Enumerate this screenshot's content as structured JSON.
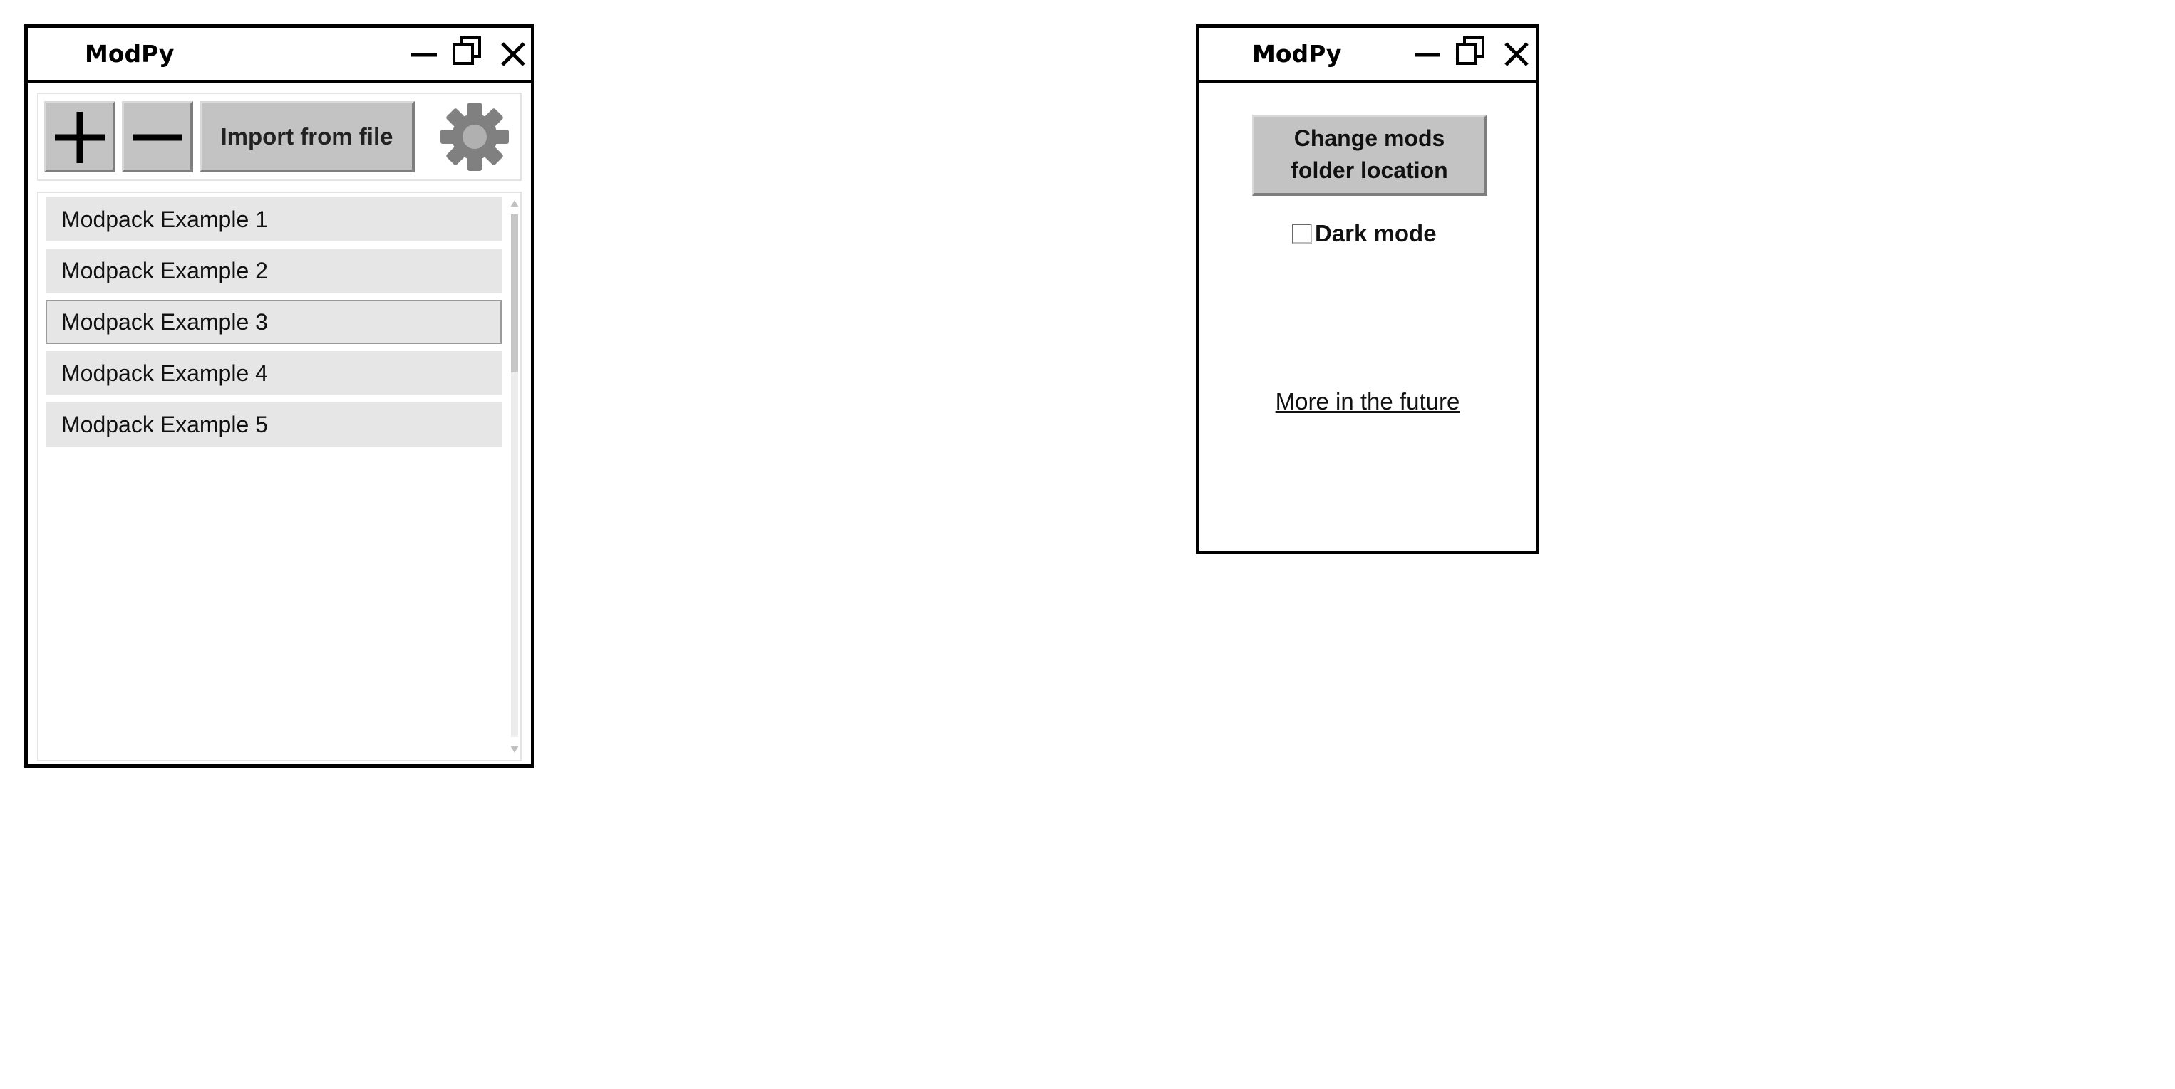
{
  "main_window": {
    "title": "ModPy",
    "toolbar": {
      "add_icon": "plus-icon",
      "remove_icon": "minus-icon",
      "import_label": "Import from file",
      "settings_icon": "gear-icon"
    },
    "modpacks": [
      {
        "label": "Modpack Example 1",
        "selected": false
      },
      {
        "label": "Modpack Example 2",
        "selected": false
      },
      {
        "label": "Modpack Example 3",
        "selected": true
      },
      {
        "label": "Modpack Example 4",
        "selected": false
      },
      {
        "label": "Modpack Example 5",
        "selected": false
      }
    ]
  },
  "settings_window": {
    "title": "ModPy",
    "change_folder_line1": "Change mods",
    "change_folder_line2": "folder location",
    "dark_mode_label": "Dark mode",
    "dark_mode_checked": false,
    "future_text": "More in the future"
  },
  "colors": {
    "button_face": "#c3c3c3",
    "list_item": "#e6e6e6",
    "gear": "#808080",
    "border": "#000000"
  }
}
